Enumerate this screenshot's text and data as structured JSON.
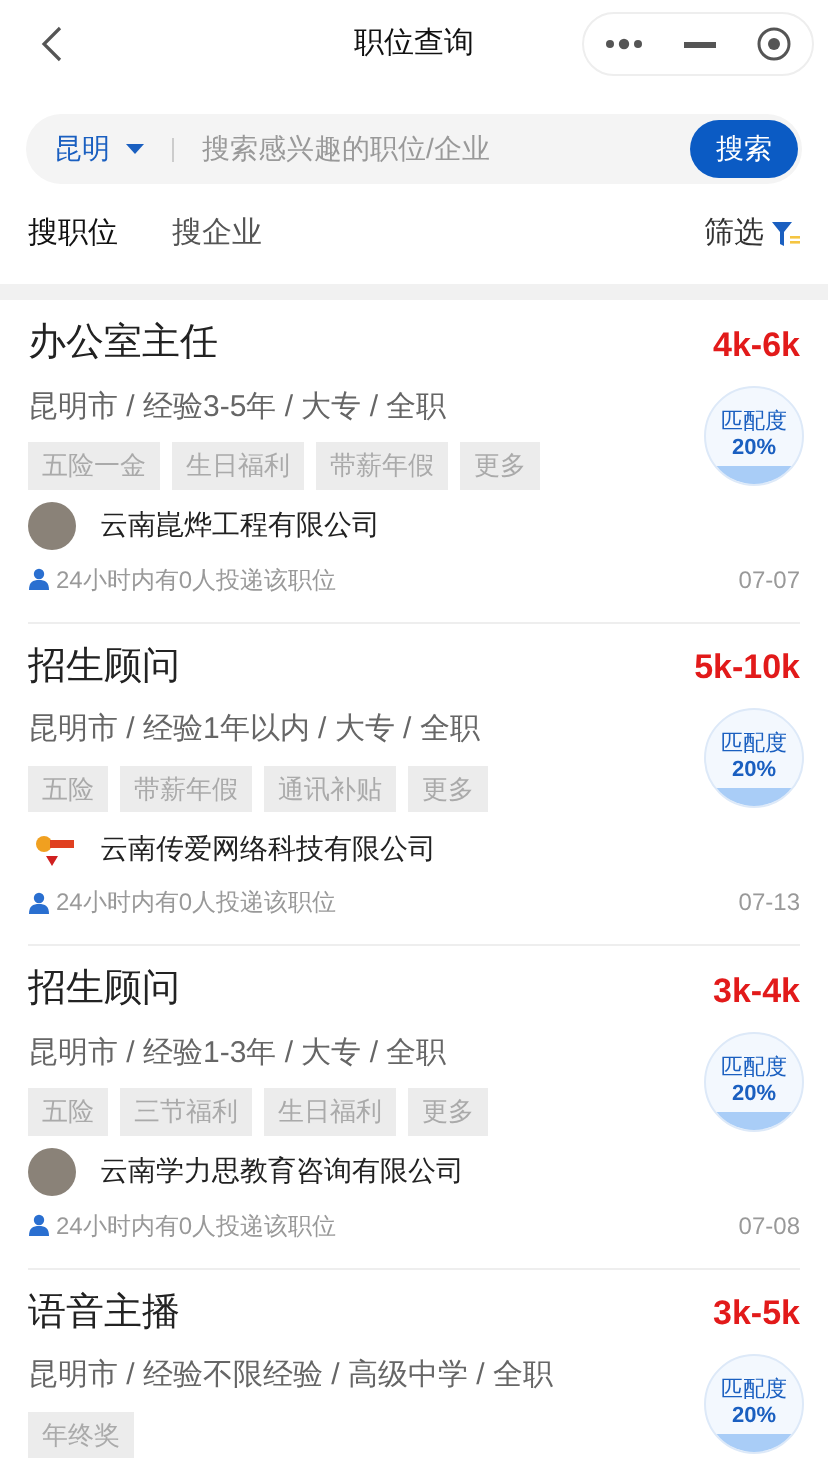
{
  "header": {
    "title": "职位查询"
  },
  "search": {
    "city": "昆明",
    "placeholder": "搜索感兴趣的职位/企业",
    "button": "搜索"
  },
  "tabs": [
    {
      "label": "搜职位",
      "selected": true
    },
    {
      "label": "搜企业",
      "selected": false
    }
  ],
  "filter": {
    "label": "筛选"
  },
  "jobs": [
    {
      "title": "办公室主任",
      "salary": "4k-6k",
      "meta": "昆明市 / 经验3-5年 / 大专 / 全职",
      "tags": [
        "五险一金",
        "生日福利",
        "带薪年假",
        "更多"
      ],
      "match_label": "匹配度",
      "match": "20%",
      "company": "云南崑烨工程有限公司",
      "logo": {
        "kind": "photo"
      },
      "applicants": "24小时内有0人投递该职位",
      "date": "07-07"
    },
    {
      "title": "招生顾问",
      "salary": "5k-10k",
      "meta": "昆明市 / 经验1年以内 / 大专 / 全职",
      "tags": [
        "五险",
        "带薪年假",
        "通讯补贴",
        "更多"
      ],
      "match_label": "匹配度",
      "match": "20%",
      "company": "云南传爱网络科技有限公司",
      "logo": {
        "kind": "logo"
      },
      "applicants": "24小时内有0人投递该职位",
      "date": "07-13"
    },
    {
      "title": "招生顾问",
      "salary": "3k-4k",
      "meta": "昆明市 / 经验1-3年 / 大专 / 全职",
      "tags": [
        "五险",
        "三节福利",
        "生日福利",
        "更多"
      ],
      "match_label": "匹配度",
      "match": "20%",
      "company": "云南学力思教育咨询有限公司",
      "logo": {
        "kind": "photo"
      },
      "applicants": "24小时内有0人投递该职位",
      "date": "07-08"
    },
    {
      "title": "语音主播",
      "salary": "3k-5k",
      "meta": "昆明市 / 经验不限经验 / 高级中学 / 全职",
      "tags": [
        "年终奖"
      ],
      "match_label": "匹配度",
      "match": "20%"
    }
  ]
}
